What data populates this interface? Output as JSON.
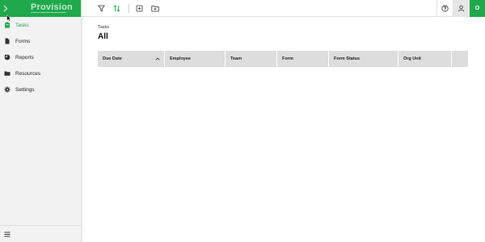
{
  "app": {
    "brand": "Provision",
    "brand_color": "#1fa94c",
    "brand_text_color": "#bde9c9"
  },
  "sidebar": {
    "items": [
      {
        "label": "Tasks",
        "icon": "clipboard-icon",
        "active": true
      },
      {
        "label": "Forms",
        "icon": "document-icon",
        "active": false
      },
      {
        "label": "Reports",
        "icon": "pie-chart-icon",
        "active": false
      },
      {
        "label": "Resources",
        "icon": "folder-icon",
        "active": false
      },
      {
        "label": "Settings",
        "icon": "gear-icon",
        "active": false
      }
    ],
    "footer_icon": "hamburger-menu-icon"
  },
  "toolbar": {
    "icons": [
      "filter-icon",
      "sort-icon",
      "add-item-icon",
      "add-folder-icon"
    ],
    "right": {
      "help_icon": "help-icon",
      "user_icon": "user-icon",
      "avatar_initial": "O"
    }
  },
  "main": {
    "breadcrumb": "Tasks",
    "title": "All",
    "table": {
      "columns": [
        {
          "label": "Due Date",
          "sorted": "asc"
        },
        {
          "label": "Employee"
        },
        {
          "label": "Team"
        },
        {
          "label": "Form"
        },
        {
          "label": "Form Status"
        },
        {
          "label": "Org Unit"
        },
        {
          "label": ""
        }
      ]
    }
  }
}
